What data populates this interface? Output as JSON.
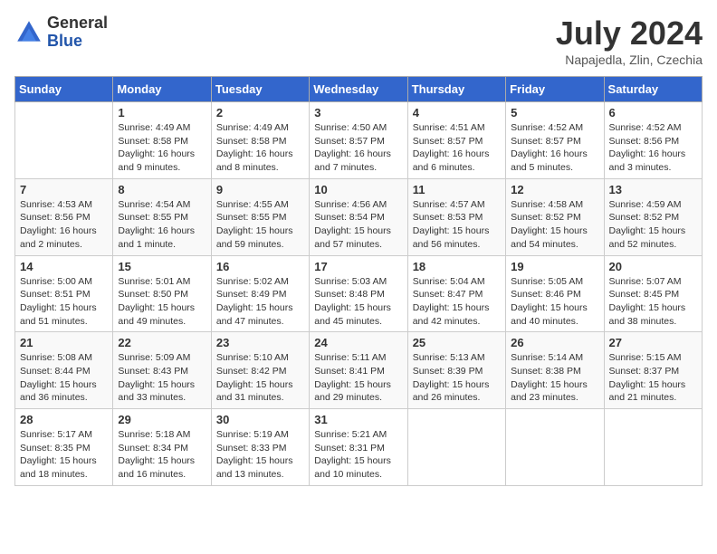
{
  "logo": {
    "general": "General",
    "blue": "Blue"
  },
  "title": "July 2024",
  "location": "Napajedla, Zlin, Czechia",
  "days_of_week": [
    "Sunday",
    "Monday",
    "Tuesday",
    "Wednesday",
    "Thursday",
    "Friday",
    "Saturday"
  ],
  "weeks": [
    [
      {
        "day": "",
        "info": ""
      },
      {
        "day": "1",
        "info": "Sunrise: 4:49 AM\nSunset: 8:58 PM\nDaylight: 16 hours\nand 9 minutes."
      },
      {
        "day": "2",
        "info": "Sunrise: 4:49 AM\nSunset: 8:58 PM\nDaylight: 16 hours\nand 8 minutes."
      },
      {
        "day": "3",
        "info": "Sunrise: 4:50 AM\nSunset: 8:57 PM\nDaylight: 16 hours\nand 7 minutes."
      },
      {
        "day": "4",
        "info": "Sunrise: 4:51 AM\nSunset: 8:57 PM\nDaylight: 16 hours\nand 6 minutes."
      },
      {
        "day": "5",
        "info": "Sunrise: 4:52 AM\nSunset: 8:57 PM\nDaylight: 16 hours\nand 5 minutes."
      },
      {
        "day": "6",
        "info": "Sunrise: 4:52 AM\nSunset: 8:56 PM\nDaylight: 16 hours\nand 3 minutes."
      }
    ],
    [
      {
        "day": "7",
        "info": "Sunrise: 4:53 AM\nSunset: 8:56 PM\nDaylight: 16 hours\nand 2 minutes."
      },
      {
        "day": "8",
        "info": "Sunrise: 4:54 AM\nSunset: 8:55 PM\nDaylight: 16 hours\nand 1 minute."
      },
      {
        "day": "9",
        "info": "Sunrise: 4:55 AM\nSunset: 8:55 PM\nDaylight: 15 hours\nand 59 minutes."
      },
      {
        "day": "10",
        "info": "Sunrise: 4:56 AM\nSunset: 8:54 PM\nDaylight: 15 hours\nand 57 minutes."
      },
      {
        "day": "11",
        "info": "Sunrise: 4:57 AM\nSunset: 8:53 PM\nDaylight: 15 hours\nand 56 minutes."
      },
      {
        "day": "12",
        "info": "Sunrise: 4:58 AM\nSunset: 8:52 PM\nDaylight: 15 hours\nand 54 minutes."
      },
      {
        "day": "13",
        "info": "Sunrise: 4:59 AM\nSunset: 8:52 PM\nDaylight: 15 hours\nand 52 minutes."
      }
    ],
    [
      {
        "day": "14",
        "info": "Sunrise: 5:00 AM\nSunset: 8:51 PM\nDaylight: 15 hours\nand 51 minutes."
      },
      {
        "day": "15",
        "info": "Sunrise: 5:01 AM\nSunset: 8:50 PM\nDaylight: 15 hours\nand 49 minutes."
      },
      {
        "day": "16",
        "info": "Sunrise: 5:02 AM\nSunset: 8:49 PM\nDaylight: 15 hours\nand 47 minutes."
      },
      {
        "day": "17",
        "info": "Sunrise: 5:03 AM\nSunset: 8:48 PM\nDaylight: 15 hours\nand 45 minutes."
      },
      {
        "day": "18",
        "info": "Sunrise: 5:04 AM\nSunset: 8:47 PM\nDaylight: 15 hours\nand 42 minutes."
      },
      {
        "day": "19",
        "info": "Sunrise: 5:05 AM\nSunset: 8:46 PM\nDaylight: 15 hours\nand 40 minutes."
      },
      {
        "day": "20",
        "info": "Sunrise: 5:07 AM\nSunset: 8:45 PM\nDaylight: 15 hours\nand 38 minutes."
      }
    ],
    [
      {
        "day": "21",
        "info": "Sunrise: 5:08 AM\nSunset: 8:44 PM\nDaylight: 15 hours\nand 36 minutes."
      },
      {
        "day": "22",
        "info": "Sunrise: 5:09 AM\nSunset: 8:43 PM\nDaylight: 15 hours\nand 33 minutes."
      },
      {
        "day": "23",
        "info": "Sunrise: 5:10 AM\nSunset: 8:42 PM\nDaylight: 15 hours\nand 31 minutes."
      },
      {
        "day": "24",
        "info": "Sunrise: 5:11 AM\nSunset: 8:41 PM\nDaylight: 15 hours\nand 29 minutes."
      },
      {
        "day": "25",
        "info": "Sunrise: 5:13 AM\nSunset: 8:39 PM\nDaylight: 15 hours\nand 26 minutes."
      },
      {
        "day": "26",
        "info": "Sunrise: 5:14 AM\nSunset: 8:38 PM\nDaylight: 15 hours\nand 23 minutes."
      },
      {
        "day": "27",
        "info": "Sunrise: 5:15 AM\nSunset: 8:37 PM\nDaylight: 15 hours\nand 21 minutes."
      }
    ],
    [
      {
        "day": "28",
        "info": "Sunrise: 5:17 AM\nSunset: 8:35 PM\nDaylight: 15 hours\nand 18 minutes."
      },
      {
        "day": "29",
        "info": "Sunrise: 5:18 AM\nSunset: 8:34 PM\nDaylight: 15 hours\nand 16 minutes."
      },
      {
        "day": "30",
        "info": "Sunrise: 5:19 AM\nSunset: 8:33 PM\nDaylight: 15 hours\nand 13 minutes."
      },
      {
        "day": "31",
        "info": "Sunrise: 5:21 AM\nSunset: 8:31 PM\nDaylight: 15 hours\nand 10 minutes."
      },
      {
        "day": "",
        "info": ""
      },
      {
        "day": "",
        "info": ""
      },
      {
        "day": "",
        "info": ""
      }
    ]
  ]
}
